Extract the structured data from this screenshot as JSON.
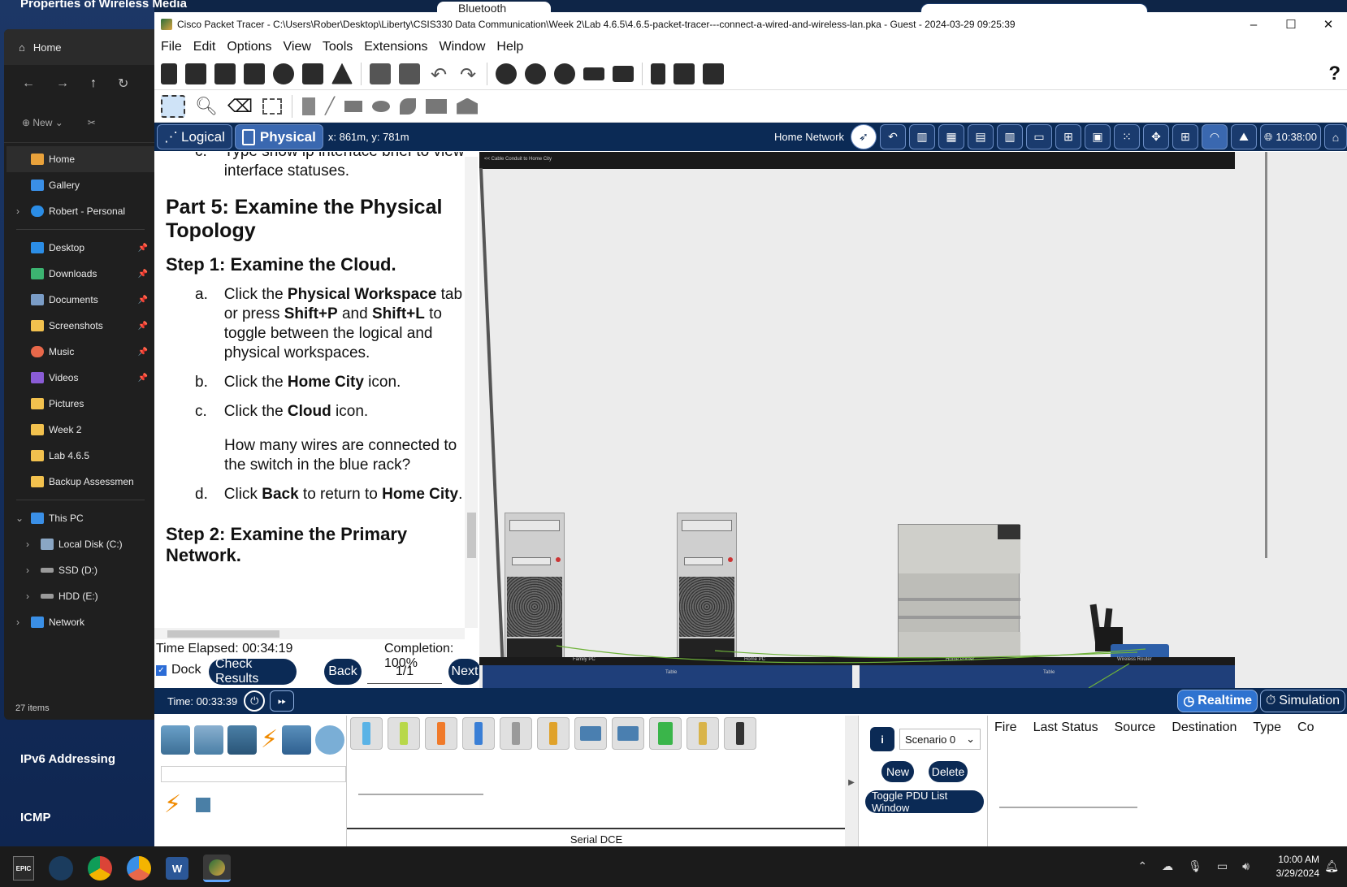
{
  "background": {
    "top_label": "Properties of Wireless Media",
    "behind_label": "Bluetooth",
    "ipv6_label": "IPv6 Addressing",
    "icmp_label": "ICMP"
  },
  "explorer": {
    "header": "Home",
    "new_label": "New",
    "nav": {
      "home": "Home",
      "gallery": "Gallery",
      "personal": "Robert - Personal",
      "desktop": "Desktop",
      "downloads": "Downloads",
      "documents": "Documents",
      "screenshots": "Screenshots",
      "music": "Music",
      "videos": "Videos",
      "pictures": "Pictures",
      "week2": "Week 2",
      "lab": "Lab 4.6.5",
      "backup": "Backup Assessmen",
      "thispc": "This PC",
      "localc": "Local Disk (C:)",
      "ssd": "SSD (D:)",
      "hdd": "HDD (E:)",
      "network": "Network"
    },
    "status": "27 items"
  },
  "window": {
    "title": "Cisco Packet Tracer - C:\\Users\\Rober\\Desktop\\Liberty\\CSIS330 Data Communication\\Week 2\\Lab 4.6.5\\4.6.5-packet-tracer---connect-a-wired-and-wireless-lan.pka - Guest - 2024-03-29 09:25:39",
    "min": "–",
    "max": "☐",
    "close": "✕"
  },
  "menu": {
    "file": "File",
    "edit": "Edit",
    "options": "Options",
    "view": "View",
    "tools": "Tools",
    "extensions": "Extensions",
    "window": "Window",
    "help": "Help"
  },
  "help_q": "?",
  "navbar": {
    "logical": "Logical",
    "physical": "Physical",
    "coords": "x: 861m, y: 781m",
    "location": "Home Network",
    "time": "10:38:00"
  },
  "instructions": {
    "partial_top": "c.",
    "partial_top_text": "Type show ip interface brief to view interface statuses.",
    "part5": "Part 5: Examine the Physical Topology",
    "step1": "Step 1: Examine the Cloud.",
    "a_letter": "a.",
    "a_pre": "Click the ",
    "a_b1": "Physical Workspace",
    "a_mid1": " tab or press ",
    "a_b2": "Shift+P",
    "a_mid2": " and ",
    "a_b3": "Shift+L",
    "a_post": " to toggle between the logical and physical workspaces.",
    "b_letter": "b.",
    "b_pre": "Click the ",
    "b_b": "Home City",
    "b_post": " icon.",
    "c_letter": "c.",
    "c_pre": "Click the ",
    "c_b": "Cloud",
    "c_post": " icon.",
    "question": "How many wires are connected to the switch in the blue rack?",
    "d_letter": "d.",
    "d_pre": "Click ",
    "d_b1": "Back",
    "d_mid": " to return to ",
    "d_b2": "Home City",
    "d_post": ".",
    "step2": "Step 2: Examine the Primary Network."
  },
  "controls": {
    "time_elapsed": "Time Elapsed: 00:34:19",
    "completion": "Completion: 100%",
    "dock": "Dock",
    "check": "Check Results",
    "back": "Back",
    "page": "1/1",
    "next": "Next"
  },
  "workspace": {
    "banner": "<< Cable Conduit to Home City",
    "labels": {
      "family_pc": "Family PC",
      "home_pc": "Home PC",
      "home_printer": "Home Printer",
      "wireless_router": "Wireless Router",
      "table1": "Table",
      "table2": "Table"
    }
  },
  "timebar": {
    "time": "Time: 00:33:39",
    "realtime": "Realtime",
    "simulation": "Simulation"
  },
  "pdu": {
    "scenario": "Scenario 0",
    "new": "New",
    "delete": "Delete",
    "toggle": "Toggle PDU List Window",
    "headers": [
      "Fire",
      "Last Status",
      "Source",
      "Destination",
      "Type",
      "Co"
    ]
  },
  "device_panel": {
    "selected_label": "Serial DCE"
  },
  "taskbar": {
    "time": "10:00 AM",
    "date": "3/29/2024"
  }
}
